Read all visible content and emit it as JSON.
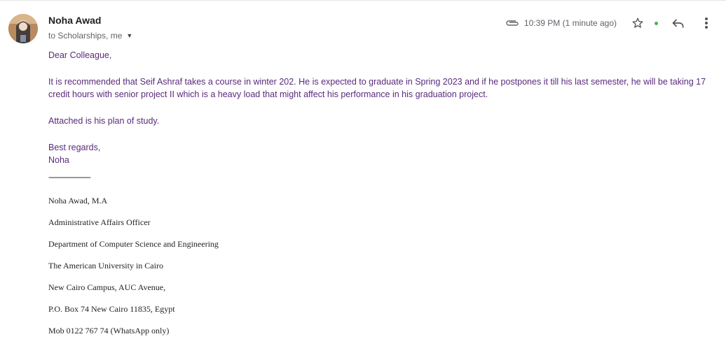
{
  "sender": {
    "name": "Noha Awad",
    "recipients": "to Scholarships, me"
  },
  "meta": {
    "timestamp": "10:39 PM (1 minute ago)"
  },
  "icons": {
    "attachment": "paperclip-icon",
    "star": "star-icon",
    "status": "green-dot-icon",
    "reply": "reply-icon",
    "more": "more-vert-icon",
    "caret": "chevron-down-icon"
  },
  "colors": {
    "body_text": "#5a2a7c",
    "status_dot": "#4caf50"
  },
  "message": {
    "greeting": "Dear Colleague,",
    "paragraph1": "It is recommended that Seif Ashraf takes a course in winter 202. He is expected to graduate in Spring 2023 and if he postpones it till his last semester, he will be taking 17 credit hours with senior project II which is a heavy load that might affect his performance in his graduation project.",
    "paragraph2": "Attached is his plan of study.",
    "closing": "Best regards,",
    "closing_name": "Noha",
    "separator": "--------------------"
  },
  "signature": {
    "name": "Noha Awad, M.A",
    "title": "Administrative Affairs Officer",
    "department": "Department of Computer Science and Engineering",
    "university": "The American University in Cairo",
    "campus": "New Cairo Campus, AUC Avenue,",
    "address": "P.O. Box 74 New Cairo 11835, Egypt",
    "mobile": "Mob 0122 767 74 (WhatsApp only)"
  }
}
